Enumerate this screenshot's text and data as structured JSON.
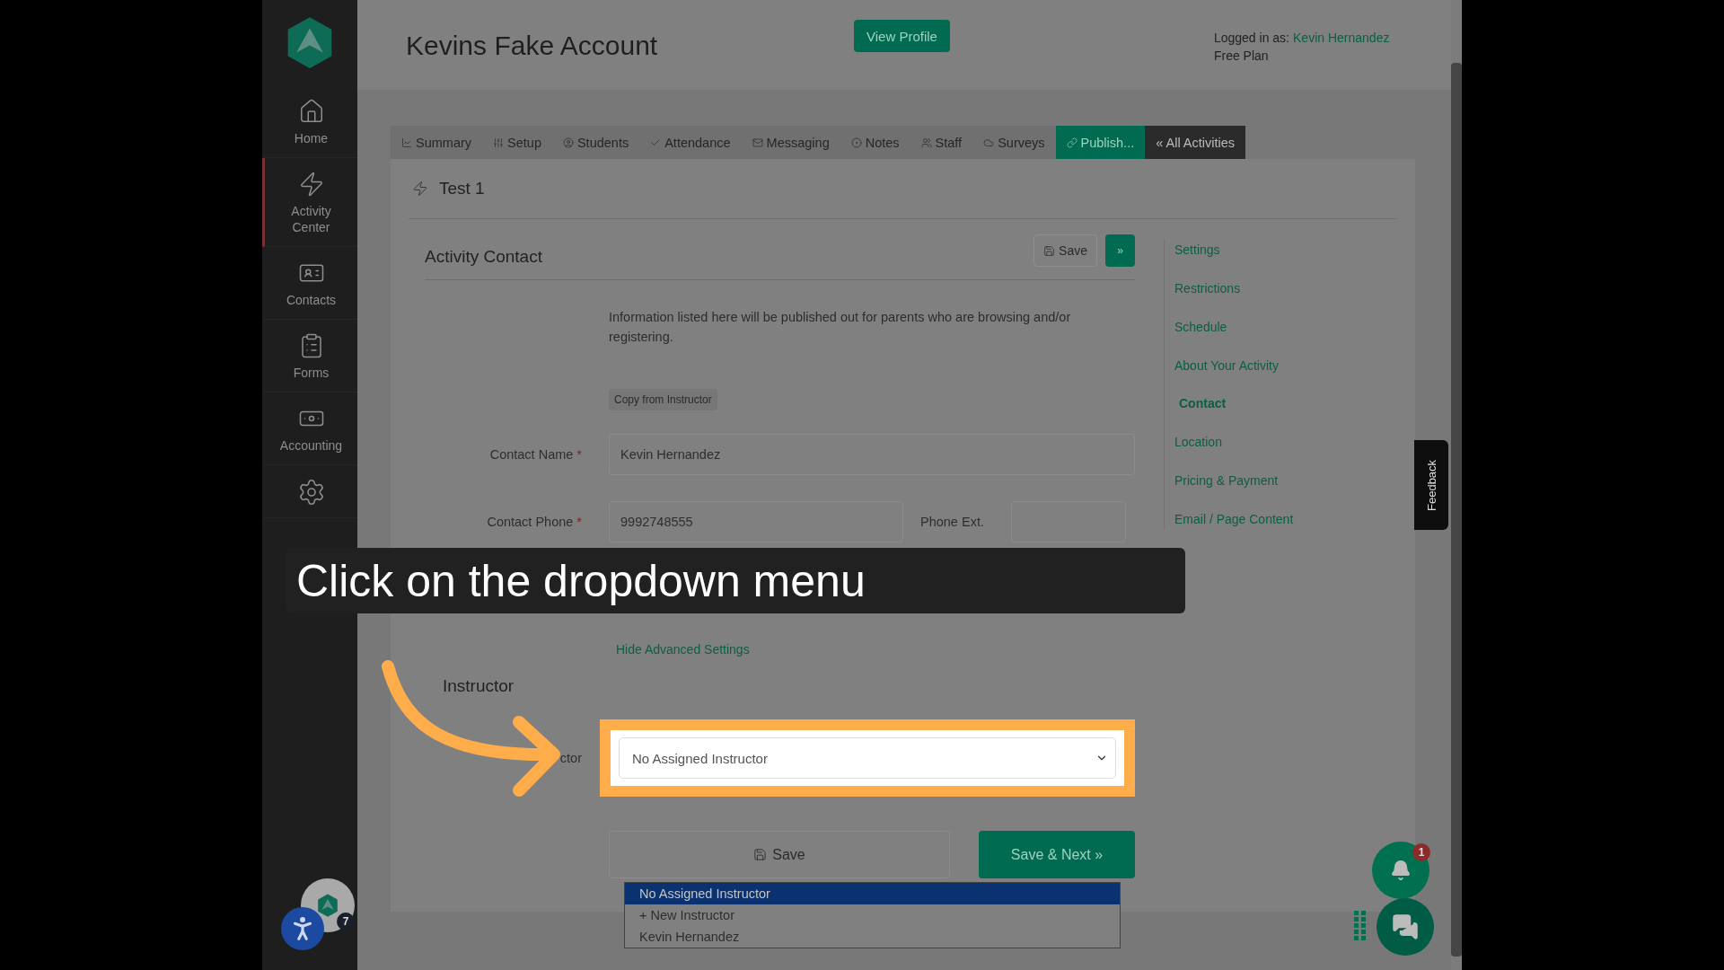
{
  "sidebar": {
    "items": [
      {
        "kind": "home",
        "label": "Home",
        "selected": false
      },
      {
        "kind": "activity",
        "label": "Activity Center",
        "selected": true
      },
      {
        "kind": "contacts",
        "label": "Contacts",
        "selected": false
      },
      {
        "kind": "forms",
        "label": "Forms",
        "selected": false
      },
      {
        "kind": "accounting",
        "label": "Accounting",
        "selected": false
      }
    ],
    "avatar_badge": "7"
  },
  "header": {
    "title": "Kevins Fake Account",
    "view_profile": "View Profile",
    "logged_in_label": "Logged in as:",
    "user": "Kevin Hernandez",
    "plan": "Free Plan"
  },
  "tabs": [
    {
      "kind": "summary",
      "label": "Summary",
      "selected": false
    },
    {
      "kind": "setup",
      "label": "Setup",
      "selected": false
    },
    {
      "kind": "students",
      "label": "Students",
      "selected": false
    },
    {
      "kind": "attendance",
      "label": "Attendance",
      "selected": false
    },
    {
      "kind": "messaging",
      "label": "Messaging",
      "selected": false
    },
    {
      "kind": "notes",
      "label": "Notes",
      "selected": false
    },
    {
      "kind": "staff",
      "label": "Staff",
      "selected": false
    },
    {
      "kind": "surveys",
      "label": "Surveys",
      "selected": false
    },
    {
      "kind": "publish",
      "label": "Publish...",
      "selected": true
    },
    {
      "kind": "back",
      "label": "« All Activities",
      "selected": false
    }
  ],
  "activity": {
    "name": "Test 1"
  },
  "section": {
    "title": "Activity Contact",
    "save": "Save",
    "next": "»"
  },
  "info": "Information listed here will be published out for parents who are browsing and/or registering.",
  "copy_button": "Copy from Instructor",
  "contact_name": {
    "label": "Contact Name",
    "required_mark": "*",
    "value": "Kevin Hernandez"
  },
  "contact_phone": {
    "label": "Contact Phone",
    "required_mark": "*",
    "value": "9992748555"
  },
  "phone_ext": {
    "label": "Phone Ext."
  },
  "advanced_link": "Hide Advanced Settings",
  "instructor": {
    "heading": "Instructor",
    "label_fragment": "ctor",
    "select_value": "No Assigned Instructor",
    "options": [
      {
        "label": "No Assigned Instructor",
        "selected": true
      },
      {
        "label": "+ New Instructor",
        "selected": false
      },
      {
        "label": "Kevin Hernandez",
        "selected": false
      }
    ]
  },
  "footer_buttons": {
    "save": "Save",
    "save_next": "Save & Next »"
  },
  "section_nav": [
    {
      "label": "Settings",
      "selected": false
    },
    {
      "label": "Restrictions",
      "selected": false
    },
    {
      "label": "Schedule",
      "selected": false
    },
    {
      "label": "About Your Activity",
      "selected": false
    },
    {
      "label": "Contact",
      "selected": true
    },
    {
      "label": "Location",
      "selected": false
    },
    {
      "label": "Pricing & Payment",
      "selected": false
    },
    {
      "label": "Email / Page Content",
      "selected": false
    }
  ],
  "feedback": "Feedback",
  "notifications_badge": "1",
  "caption": "Click on the dropdown menu"
}
